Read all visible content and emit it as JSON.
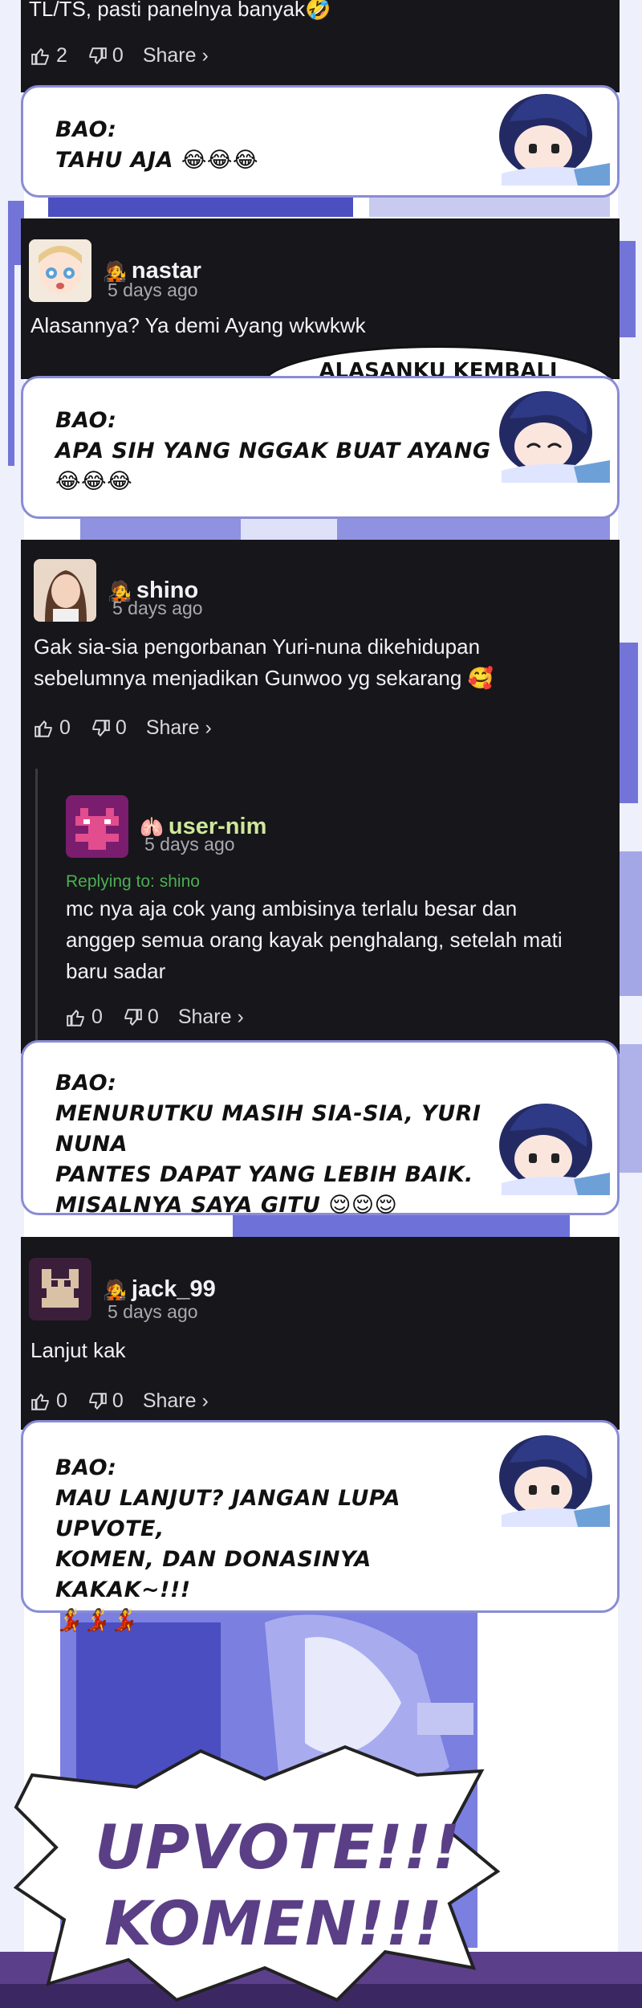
{
  "top_comment": {
    "text": "TL/TS, pasti panelnya banyak🤣",
    "likes": "2",
    "dislikes": "0",
    "share": "Share ›"
  },
  "bubbles": [
    {
      "speaker": "BAO:",
      "line1": "TAHU AJA 😂😂😂",
      "line2": "",
      "line3": ""
    },
    {
      "speaker": "BAO:",
      "line1": "APA SIH YANG NGGAK BUAT AYANG",
      "line2": "😂😂😂",
      "line3": ""
    },
    {
      "speaker": "BAO:",
      "line1": "MENURUTKU MASIH SIA-SIA, YURI NUNA",
      "line2": "PANTES DAPAT YANG LEBIH BAIK.",
      "line3": "MISALNYA SAYA GITU 😌😌😌"
    },
    {
      "speaker": "BAO:",
      "line1": "MAU LANJUT? JANGAN LUPA UPVOTE,",
      "line2": "KOMEN, DAN DONASINYA KAKAK~!!!",
      "line3": "💃💃💃"
    }
  ],
  "comments": [
    {
      "badge": "🧑‍🎤",
      "username": "nastar",
      "ago": "5 days ago",
      "text": "Alasannya? Ya demi Ayang wkwkwk",
      "panel_text": "ALASANKU KEMBALI"
    },
    {
      "badge": "🧑‍🎤",
      "username": "shino",
      "ago": "5 days ago",
      "text1": "Gak sia-sia pengorbanan Yuri-nuna dikehidupan",
      "text2": "sebelumnya menjadikan Gunwoo yg sekarang 🥰",
      "likes": "0",
      "dislikes": "0",
      "share": "Share ›"
    },
    {
      "badge": "🫁",
      "username": "user-nim",
      "ago": "5 days ago",
      "replying": "Replying to: shino",
      "text1": "mc nya aja cok yang ambisinya terlalu besar dan",
      "text2": "anggep semua orang kayak penghalang, setelah mati",
      "text3": "baru sadar",
      "likes": "0",
      "dislikes": "0",
      "share": "Share ›"
    },
    {
      "badge": "🧑‍🎤",
      "username": "jack_99",
      "ago": "5 days ago",
      "text": "Lanjut kak",
      "likes": "0",
      "dislikes": "0",
      "share": "Share ›"
    }
  ],
  "shout": {
    "line1": "UPVOTE!!!",
    "line2": "KOMEN!!!"
  },
  "colors": {
    "dark_panel": "#16161b",
    "bubble_border": "#8a8cd6",
    "manga_tint": "#5b5fd0",
    "reply_green": "#4caf50",
    "usernim_name": "#cfe89a",
    "shout_text": "#5a3f86"
  }
}
